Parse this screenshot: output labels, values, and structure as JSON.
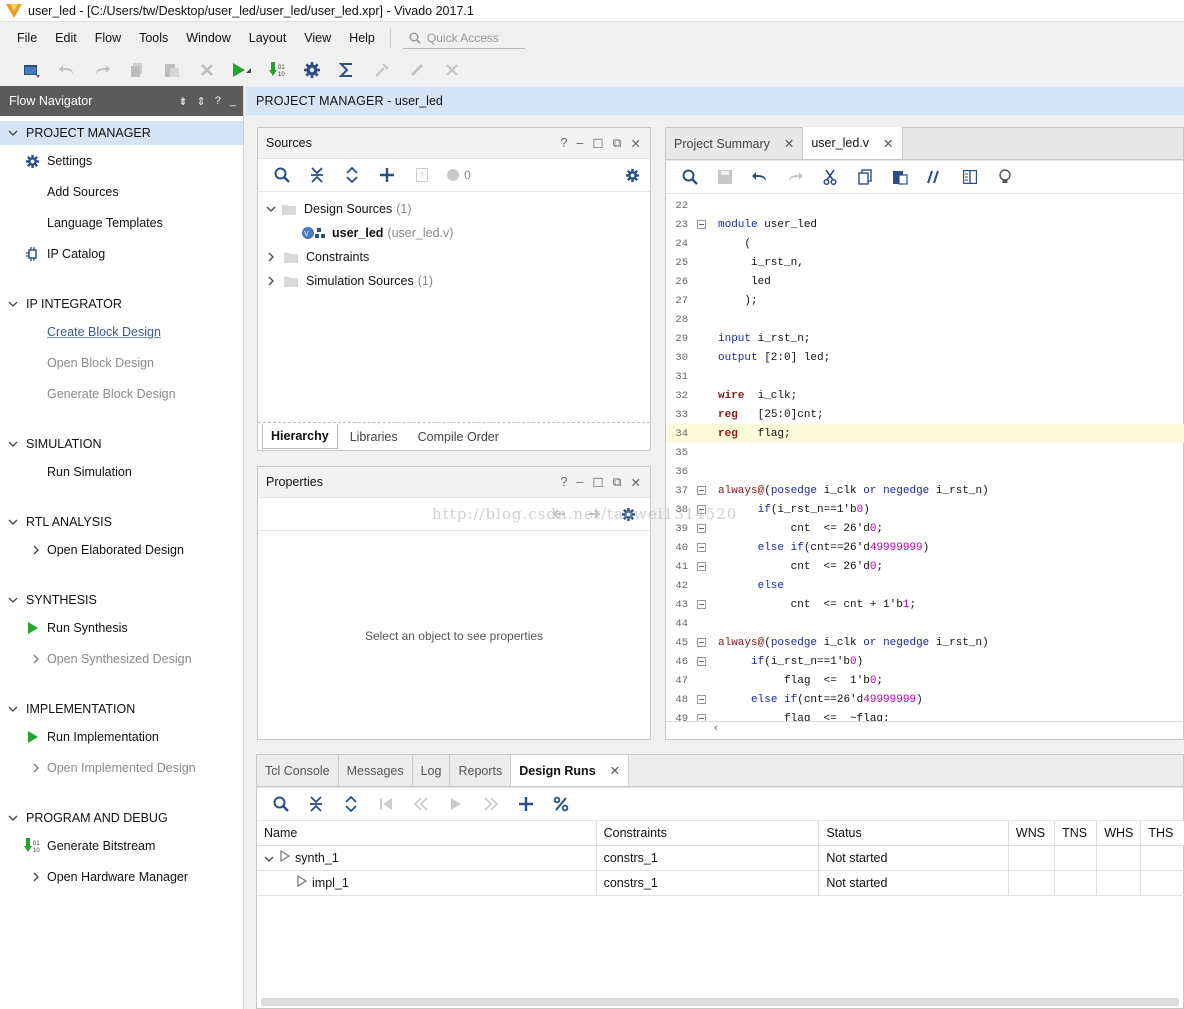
{
  "window": {
    "title": "user_led - [C:/Users/tw/Desktop/user_led/user_led/user_led.xpr] - Vivado 2017.1"
  },
  "menu": [
    "File",
    "Edit",
    "Flow",
    "Tools",
    "Window",
    "Layout",
    "View",
    "Help"
  ],
  "quick_access": {
    "placeholder": "Quick Access"
  },
  "flow_navigator": {
    "title": "Flow Navigator",
    "sections": [
      {
        "title": "PROJECT MANAGER",
        "items": [
          "Settings",
          "Add Sources",
          "Language Templates",
          "IP Catalog"
        ]
      },
      {
        "title": "IP INTEGRATOR",
        "items": [
          "Create Block Design",
          "Open Block Design",
          "Generate Block Design"
        ]
      },
      {
        "title": "SIMULATION",
        "items": [
          "Run Simulation"
        ]
      },
      {
        "title": "RTL ANALYSIS",
        "items": [
          "Open Elaborated Design"
        ]
      },
      {
        "title": "SYNTHESIS",
        "items": [
          "Run Synthesis",
          "Open Synthesized Design"
        ]
      },
      {
        "title": "IMPLEMENTATION",
        "items": [
          "Run Implementation",
          "Open Implemented Design"
        ]
      },
      {
        "title": "PROGRAM AND DEBUG",
        "items": [
          "Generate Bitstream",
          "Open Hardware Manager"
        ]
      }
    ]
  },
  "header": {
    "section": "PROJECT MANAGER",
    "project": " - user_led"
  },
  "sources": {
    "title": "Sources",
    "count_badge": "0",
    "tree": {
      "design_sources": "Design Sources",
      "design_sources_count": "(1)",
      "top_module": "user_led",
      "top_module_file": "(user_led.v)",
      "constraints": "Constraints",
      "simulation_sources": "Simulation Sources",
      "simulation_sources_count": "(1)"
    },
    "tabs": [
      "Hierarchy",
      "Libraries",
      "Compile Order"
    ]
  },
  "properties": {
    "title": "Properties",
    "empty_text": "Select an object to see properties"
  },
  "editor": {
    "tabs": [
      "Project Summary",
      "user_led.v"
    ],
    "lines": [
      {
        "n": "22",
        "t": ""
      },
      {
        "n": "23",
        "t": "module user_led"
      },
      {
        "n": "24",
        "t": "    ("
      },
      {
        "n": "25",
        "t": "     i_rst_n,"
      },
      {
        "n": "26",
        "t": "     led"
      },
      {
        "n": "27",
        "t": "    );"
      },
      {
        "n": "28",
        "t": ""
      },
      {
        "n": "29",
        "t": "input i_rst_n;"
      },
      {
        "n": "30",
        "t": "output [2:0] led;"
      },
      {
        "n": "31",
        "t": ""
      },
      {
        "n": "32",
        "t": "wire  i_clk;"
      },
      {
        "n": "33",
        "t": "reg   [25:0]cnt;"
      },
      {
        "n": "34",
        "t": "reg   flag;"
      },
      {
        "n": "35",
        "t": ""
      },
      {
        "n": "36",
        "t": ""
      },
      {
        "n": "37",
        "t": "always@(posedge i_clk or negedge i_rst_n)"
      },
      {
        "n": "38",
        "t": "      if(i_rst_n==1'b0)"
      },
      {
        "n": "39",
        "t": "           cnt  <= 26'd0;"
      },
      {
        "n": "40",
        "t": "      else if(cnt==26'd49999999)"
      },
      {
        "n": "41",
        "t": "           cnt  <= 26'd0;"
      },
      {
        "n": "42",
        "t": "      else"
      },
      {
        "n": "43",
        "t": "           cnt  <= cnt + 1'b1;"
      },
      {
        "n": "44",
        "t": ""
      },
      {
        "n": "45",
        "t": "always@(posedge i_clk or negedge i_rst_n)"
      },
      {
        "n": "46",
        "t": "     if(i_rst_n==1'b0)"
      },
      {
        "n": "47",
        "t": "          flag  <=  1'b0;"
      },
      {
        "n": "48",
        "t": "     else if(cnt==26'd49999999)"
      },
      {
        "n": "49",
        "t": "          flag  <=  ~flag;"
      }
    ]
  },
  "console": {
    "tabs": [
      "Tcl Console",
      "Messages",
      "Log",
      "Reports",
      "Design Runs"
    ],
    "columns": [
      "Name",
      "Constraints",
      "Status",
      "WNS",
      "TNS",
      "WHS",
      "THS"
    ],
    "rows": [
      {
        "name": "synth_1",
        "constraints": "constrs_1",
        "status": "Not started"
      },
      {
        "name": "impl_1",
        "constraints": "constrs_1",
        "status": "Not started"
      }
    ]
  },
  "watermark": "http://blog.csdn.net/taowei1314520"
}
